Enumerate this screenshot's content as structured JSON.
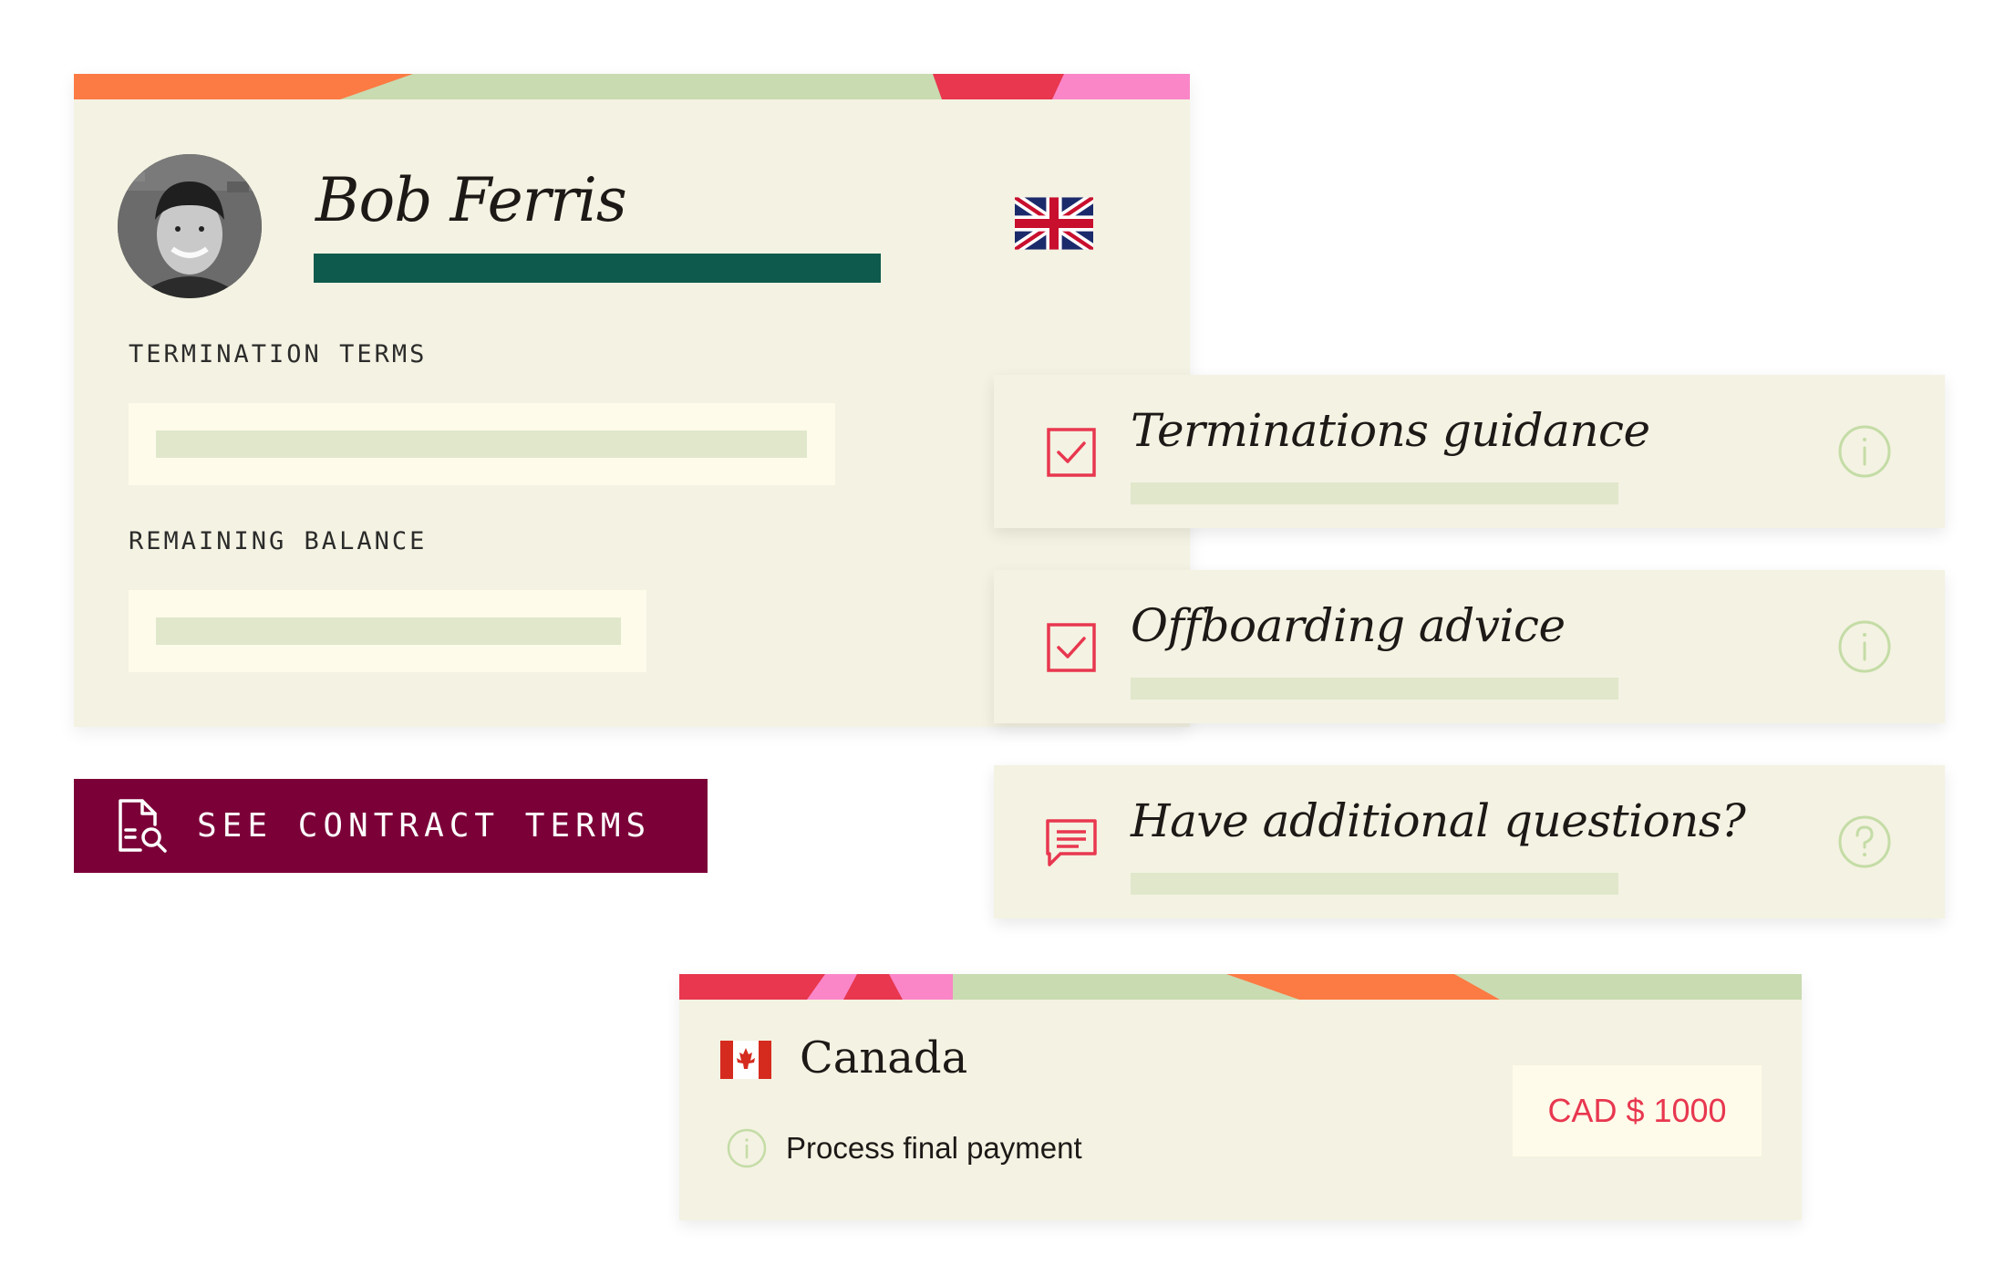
{
  "employee": {
    "name": "Bob Ferris",
    "country_flag": "uk-flag",
    "termination_label": "TERMINATION TERMS",
    "balance_label": "REMAINING BALANCE"
  },
  "contract_button": {
    "label": "SEE CONTRACT TERMS",
    "icon": "document-search-icon"
  },
  "guidance": [
    {
      "title": "Terminations guidance",
      "status_icon": "checked-checkbox-icon",
      "help_icon": "info-icon"
    },
    {
      "title": "Offboarding advice",
      "status_icon": "checked-checkbox-icon",
      "help_icon": "info-icon"
    },
    {
      "title": "Have additional questions?",
      "status_icon": "chat-bubble-icon",
      "help_icon": "question-icon"
    }
  ],
  "payment": {
    "country": "Canada",
    "country_flag": "canada-flag",
    "task": "Process final payment",
    "amount": "CAD $ 1000"
  },
  "colors": {
    "card_bg": "#f4f2e2",
    "field_bg": "#fefbea",
    "placeholder_green": "#e0e7cb",
    "name_bar": "#0e5a4d",
    "button_bg": "#7b0038",
    "accent_red": "#e8374f",
    "accent_orange": "#fc7a43",
    "accent_pink": "#fa86c8",
    "accent_sage": "#c9dbb1",
    "info_green": "#c4dca6"
  }
}
